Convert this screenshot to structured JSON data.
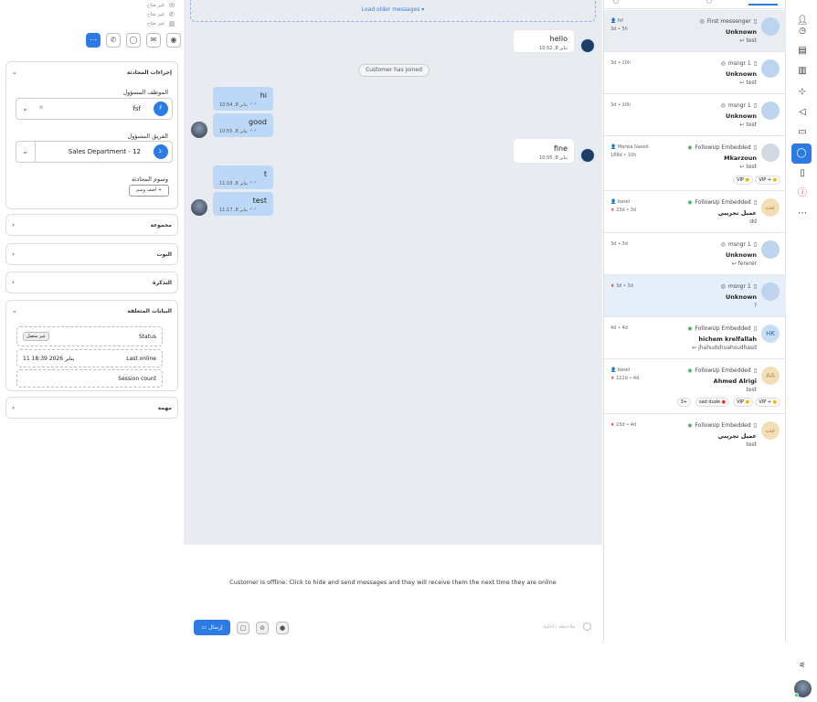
{
  "contact": {
    "lines": [
      "غير متاح",
      "غير متاح",
      "غير متاح"
    ]
  },
  "panel": {
    "conv_actions_title": "إجراءات المحادثة",
    "assignee_label": "الموظف المسؤول",
    "assignee_value": "fsf",
    "assignee_initial": "F",
    "team_label": "الفريق المسؤول",
    "team_value": "Sales Department - 12",
    "team_badge": "1-",
    "tags_label": "وسوم المحادثة",
    "add_tag": "أضف وسم +",
    "sections": [
      "مجموعة",
      "البوت",
      "التذكرة",
      "البيانات المتعلقة",
      "مهمة"
    ],
    "related": {
      "status_label": "Status",
      "status_value": "غير متصل",
      "last_online_label": "Last online",
      "last_online_value": "11 يناير 2026 18:39",
      "session_label": "Session count"
    }
  },
  "chat": {
    "load_older": "Load older messages ▾",
    "joined": "Customer has joined",
    "messages": [
      {
        "text": "hello",
        "meta": "10:52 ,8 يناير"
      },
      {
        "text": "hi",
        "meta": "10:54 ,8 يناير"
      },
      {
        "text": "good",
        "meta": "10:55 ,8 يناير"
      },
      {
        "text": "fine",
        "meta": "10:55 ,8 يناير"
      },
      {
        "text": "t",
        "meta": "11:10 ,8 يناير"
      },
      {
        "text": "test",
        "meta": "11:17 ,8 يناير"
      }
    ],
    "offline_notice": "Customer is offline. Click to hide and send messages and they will receive them the next time they are online",
    "send": "إرسال",
    "internal_note": "ملاحظة داخلية"
  },
  "conversations": [
    {
      "agent": "fsf",
      "time": "3d • 5h",
      "channel": "First messenger",
      "name": "Unknown",
      "msg": "test"
    },
    {
      "agent": "",
      "time": "3d • 10h",
      "channel": "msngr 1",
      "name": "Unknown",
      "msg": "test"
    },
    {
      "agent": "",
      "time": "3d • 10h",
      "channel": "msngr 1",
      "name": "Unknown",
      "msg": "test"
    },
    {
      "agent": "Marwa Saeed",
      "time": "188d • 10h",
      "channel": "FollowUp Embedded",
      "name": "Mkarzoun",
      "msg": "test",
      "tags": [
        "VIP",
        "VIP +"
      ]
    },
    {
      "agent": "basel",
      "time": "23d • 3d",
      "channel": "FollowUp Embedded",
      "name": "عميل تجريبي",
      "msg": "dd",
      "avatar": "عت"
    },
    {
      "agent": "",
      "time": "3d • 3d",
      "channel": "msngr 1",
      "name": "Unknown",
      "msg": "fererer"
    },
    {
      "agent": "",
      "time": "3d • 3d",
      "channel": "msngr 1",
      "name": "Unknown",
      "msg": "?"
    },
    {
      "agent": "",
      "time": "4d • 4d",
      "channel": "FollowUp Embedded",
      "name": "hichem krelfallah",
      "msg": "jhahudshuahsudhasd",
      "avatar": "HK"
    },
    {
      "agent": "basel",
      "time": "122d • 4d",
      "channel": "FollowUp Embedded",
      "name": "Ahmed Alrigi",
      "msg": "test",
      "avatar": "AA",
      "tags": [
        "3+",
        "sad dude",
        "VIP",
        "VIP +"
      ]
    },
    {
      "agent": "",
      "time": "23d • 4d",
      "channel": "FollowUp Embedded",
      "name": "عميل تجريبي",
      "msg": "test",
      "avatar": "عت"
    }
  ]
}
